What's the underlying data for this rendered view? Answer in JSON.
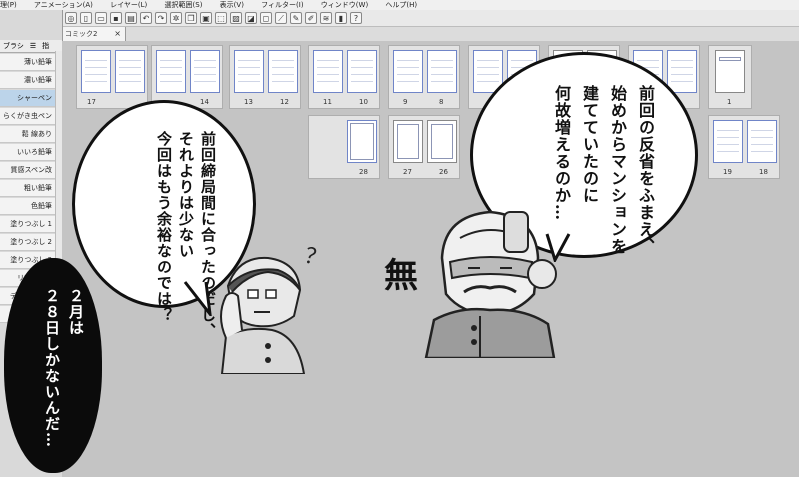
{
  "menubar": {
    "items": [
      "理(P)",
      "アニメーション(A)",
      "レイヤー(L)",
      "選択範囲(S)",
      "表示(V)",
      "フィルター(I)",
      "ウィンドウ(W)",
      "ヘルプ(H)"
    ]
  },
  "document_tab": {
    "label": "コミック2",
    "close": "×"
  },
  "sidebar": {
    "tabs": [
      "ブラシ",
      "☰",
      "指"
    ],
    "items": [
      "薄い鉛筆",
      "濃い鉛筆",
      "シャーペン",
      "らくがき虫ペン",
      "鬆 線あり",
      "いいろ鉛筆",
      "質感スペン改",
      "粗い鉛筆",
      "色鉛筆",
      "塗りつぶし 1",
      "塗りつぶし 2",
      "塗りつぶし 3",
      "リアル鉛筆",
      "デッサン鉛筆",
      "入り抜き"
    ],
    "active_index": 2,
    "bottom_value": "8"
  },
  "pages": {
    "row1_numbers": [
      "17",
      "14",
      "13",
      "12",
      "11",
      "10",
      "9",
      "8",
      "1"
    ],
    "row2_numbers": [
      "28",
      "27",
      "26",
      "19",
      "18"
    ]
  },
  "comic": {
    "bubble_left_lines": [
      "前回締局間に合ったのだし、",
      "それよりは少ない",
      "今回はもう余裕なのでは？"
    ],
    "bubble_right_lines": [
      "前回の反省をふまえ、",
      "始めからマンションを",
      "建てていたのに",
      "何故増えるのか…"
    ],
    "black_bubble_lines": [
      "２月は",
      "２８日しかないんだ…"
    ],
    "question_mark": "？",
    "sfx": "無"
  },
  "colors": {
    "active_item": "#bcd4ea",
    "canvas_bg": "#c4c4c4",
    "page_border_blue": "#7085c8"
  }
}
